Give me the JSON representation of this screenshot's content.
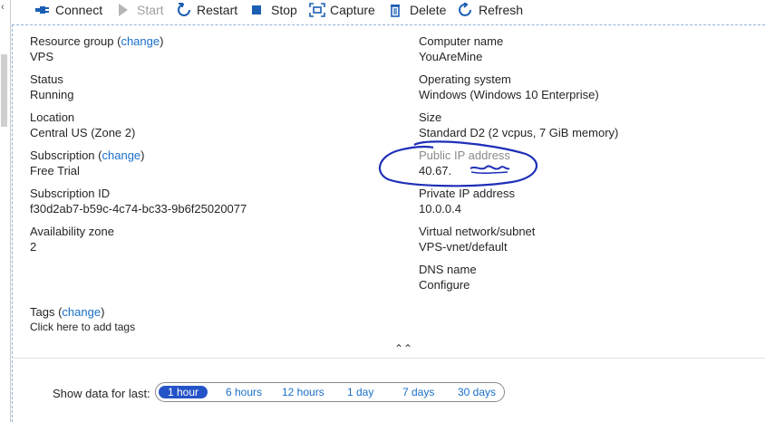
{
  "toolbar": {
    "connect": "Connect",
    "start": "Start",
    "restart": "Restart",
    "stop": "Stop",
    "capture": "Capture",
    "delete": "Delete",
    "refresh": "Refresh"
  },
  "left_column": {
    "resource_group_label": "Resource group",
    "resource_group_change": "change",
    "resource_group_value": "VPS",
    "status_label": "Status",
    "status_value": "Running",
    "location_label": "Location",
    "location_value": "Central US (Zone 2)",
    "subscription_label": "Subscription",
    "subscription_change": "change",
    "subscription_value": "Free Trial",
    "subscription_id_label": "Subscription ID",
    "subscription_id_value": "f30d2ab7-b59c-4c74-bc33-9b6f25020077",
    "availability_zone_label": "Availability zone",
    "availability_zone_value": "2"
  },
  "right_column": {
    "computer_name_label": "Computer name",
    "computer_name_value": "YouAreMine",
    "os_label": "Operating system",
    "os_value": "Windows (Windows 10 Enterprise)",
    "size_label": "Size",
    "size_value": "Standard D2 (2 vcpus, 7 GiB memory)",
    "public_ip_label": "Public IP address",
    "public_ip_value": "40.67.",
    "private_ip_label": "Private IP address",
    "private_ip_value": "10.0.0.4",
    "vnet_label": "Virtual network/subnet",
    "vnet_value": "VPS-vnet/default",
    "dns_label": "DNS name",
    "dns_value": "Configure"
  },
  "tags": {
    "label": "Tags",
    "change": "change",
    "add": "Click here to add tags"
  },
  "timerange": {
    "label": "Show data for last:",
    "options": [
      "1 hour",
      "6 hours",
      "12 hours",
      "1 day",
      "7 days",
      "30 days"
    ],
    "selected": "1 hour"
  },
  "colors": {
    "link": "#1a6fc9",
    "selected_pill": "#2453c8",
    "annotation": "#1f2fb8"
  }
}
